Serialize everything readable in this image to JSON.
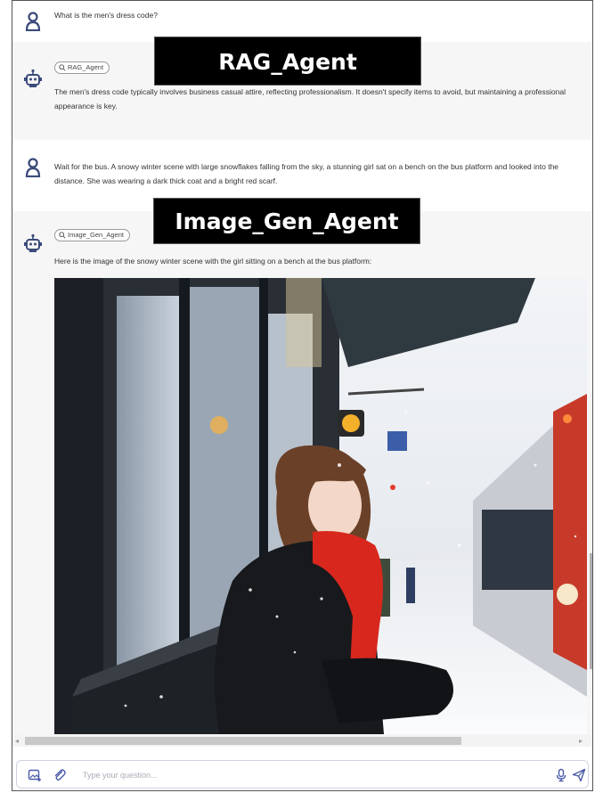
{
  "messages": [
    {
      "role": "user",
      "text": "What is the men's dress code?"
    },
    {
      "role": "agent",
      "agent_chip": "RAG_Agent",
      "text": "The men's dress code typically involves business casual attire, reflecting professionalism. It doesn't specify items to avoid, but maintaining a professional appearance is key."
    },
    {
      "role": "user",
      "text": "Wait for the bus. A snowy winter scene with large snowflakes falling from the sky, a stunning girl sat on a bench on the bus platform and looked into the distance. She was wearing a dark thick coat and a bright red scarf."
    },
    {
      "role": "agent",
      "agent_chip": "Image_Gen_Agent",
      "text": "Here is the image of the snowy winter scene with the girl sitting on a bench at the bus platform:"
    }
  ],
  "banners": {
    "rag": "RAG_Agent",
    "image_gen": "Image_Gen_Agent"
  },
  "composer": {
    "placeholder": "Type your question..."
  },
  "icons": {
    "user_avatar": "user-icon",
    "bot_avatar": "robot-icon",
    "chip": "search-icon",
    "image_upload": "image-add-icon",
    "attach": "paperclip-icon",
    "mic": "microphone-icon",
    "send": "send-icon"
  },
  "colors": {
    "avatar": "#3a4a7a",
    "banner_bg": "#000000",
    "agent_bg": "#f6f6f6",
    "accent": "#4a5aa8"
  }
}
